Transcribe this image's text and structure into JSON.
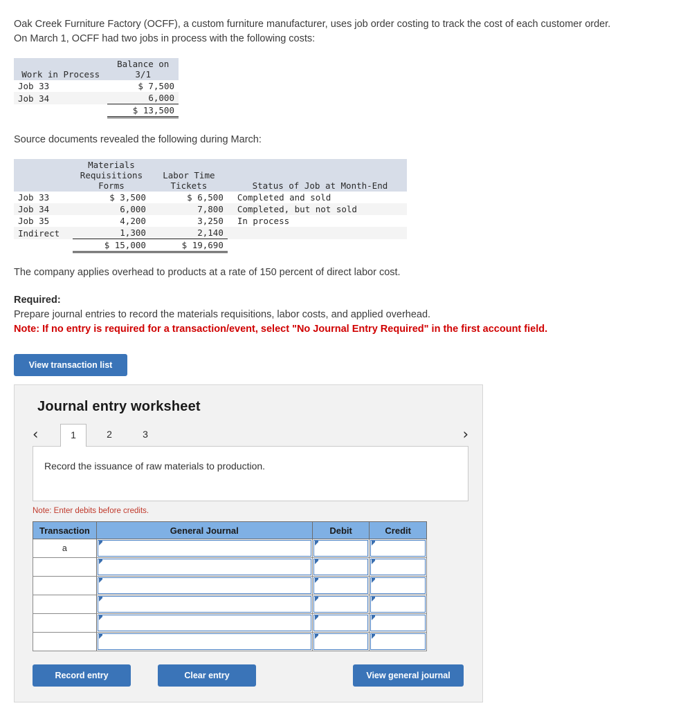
{
  "intro": {
    "line1": "Oak Creek Furniture Factory (OCFF), a custom furniture manufacturer, uses job order costing to track the cost of each customer order.",
    "line2": "On March 1, OCFF had two jobs in process with the following costs:"
  },
  "wip_table": {
    "headers": [
      "Work in Process",
      "Balance on\n3/1"
    ],
    "rows": [
      {
        "label": "Job 33",
        "balance": "$ 7,500"
      },
      {
        "label": "Job 34",
        "balance": "6,000"
      }
    ],
    "total": "$ 13,500"
  },
  "source_intro": "Source documents revealed the following during March:",
  "source_table": {
    "headers": {
      "job": "",
      "materials": "Materials\nRequisitions\nForms",
      "labor": "Labor Time\nTickets",
      "status": "Status of Job at Month-End"
    },
    "rows": [
      {
        "job": "Job 33",
        "materials": "$ 3,500",
        "labor": "$ 6,500",
        "status": "Completed and sold"
      },
      {
        "job": "Job 34",
        "materials": "6,000",
        "labor": "7,800",
        "status": "Completed, but not sold"
      },
      {
        "job": "Job 35",
        "materials": "4,200",
        "labor": "3,250",
        "status": "In process"
      },
      {
        "job": "Indirect",
        "materials": "1,300",
        "labor": "2,140",
        "status": ""
      }
    ],
    "totals": {
      "materials": "$ 15,000",
      "labor": "$ 19,690"
    }
  },
  "overhead_note": "The company applies overhead to products at a rate of 150 percent of direct labor cost.",
  "required": {
    "label": "Required:",
    "instruction": "Prepare journal entries to record the materials requisitions, labor costs, and applied overhead.",
    "note": "Note: If no entry is required for a transaction/event, select \"No Journal Entry Required\" in the first account field."
  },
  "view_transaction_list_label": "View transaction list",
  "worksheet": {
    "title": "Journal entry worksheet",
    "prev_arrow": "‹",
    "next_arrow": "›",
    "tabs": [
      {
        "label": "1",
        "active": true
      },
      {
        "label": "2",
        "active": false
      },
      {
        "label": "3",
        "active": false
      }
    ],
    "description": "Record the issuance of raw materials to production.",
    "debits_note": "Note: Enter debits before credits.",
    "journal_table": {
      "headers": [
        "Transaction",
        "General Journal",
        "Debit",
        "Credit"
      ],
      "rows": [
        {
          "transaction": "a",
          "general_journal": "",
          "debit": "",
          "credit": ""
        },
        {
          "transaction": "",
          "general_journal": "",
          "debit": "",
          "credit": ""
        },
        {
          "transaction": "",
          "general_journal": "",
          "debit": "",
          "credit": ""
        },
        {
          "transaction": "",
          "general_journal": "",
          "debit": "",
          "credit": ""
        },
        {
          "transaction": "",
          "general_journal": "",
          "debit": "",
          "credit": ""
        },
        {
          "transaction": "",
          "general_journal": "",
          "debit": "",
          "credit": ""
        }
      ]
    },
    "buttons": {
      "record_entry": "Record entry",
      "clear_entry": "Clear entry",
      "view_general_journal": "View general journal"
    }
  },
  "colors": {
    "button_blue": "#3a74b8",
    "table_header_blue": "#7fb0e4",
    "mono_header_bg": "#d7dde8",
    "note_red": "#d00000",
    "panel_bg": "#f2f2f2"
  }
}
